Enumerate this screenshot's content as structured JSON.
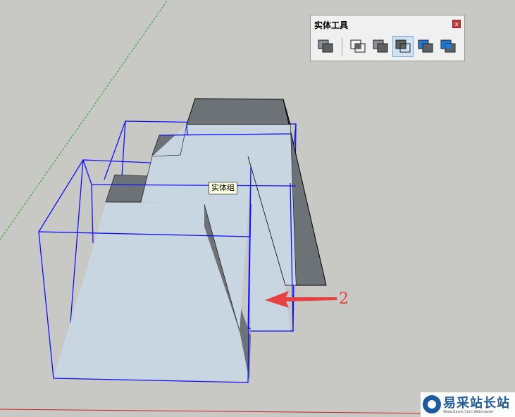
{
  "toolbar": {
    "title": "实体工具",
    "close": "x",
    "tools": [
      {
        "name": "outer-shell-icon",
        "active": false
      },
      {
        "name": "intersect-icon",
        "active": false
      },
      {
        "name": "union-icon",
        "active": false
      },
      {
        "name": "subtract-icon",
        "active": true
      },
      {
        "name": "trim-icon",
        "active": false
      },
      {
        "name": "split-icon",
        "active": false
      }
    ]
  },
  "tooltip": {
    "text": "实体组"
  },
  "annotation": {
    "number": "2",
    "color": "#e64040"
  },
  "watermark": {
    "name": "易采站长站",
    "sub": "Www.Easck.Com Webmaster"
  },
  "colors": {
    "background": "#c8c8c4",
    "solid_face_light": "#c8d6e2",
    "solid_face_dark": "#6d7276",
    "selection_box": "#1010ff",
    "green_axis": "#2aa02a",
    "red_axis": "#d02020"
  }
}
